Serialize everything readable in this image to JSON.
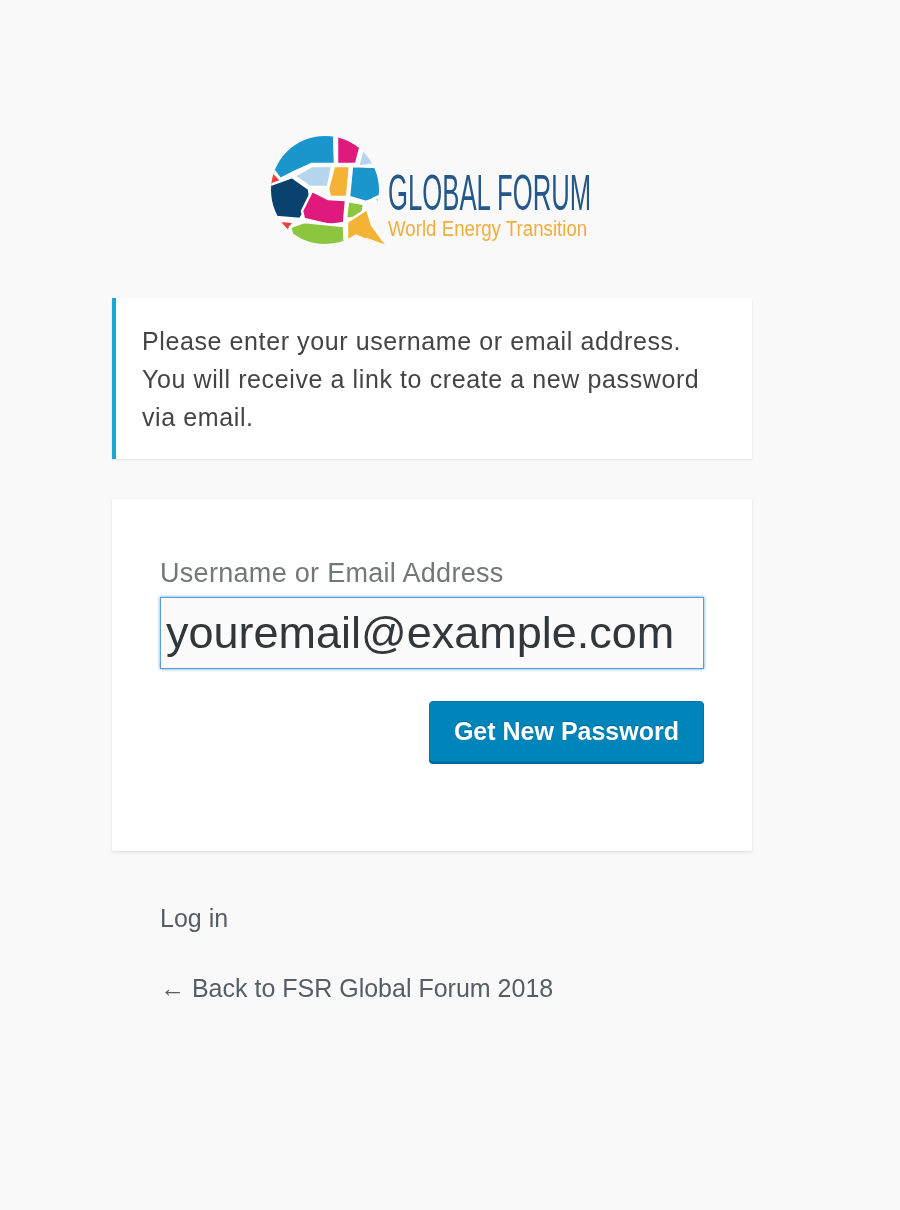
{
  "logo": {
    "title": "GLOBAL FORUM",
    "subtitle": "World Energy Transition"
  },
  "message": "Please enter your username or email address. You will receive a link to create a new password via email.",
  "form": {
    "field": {
      "label": "Username or Email Address",
      "value": "youremail@example.com",
      "focused": true
    },
    "button": "Get New Password"
  },
  "links": [
    {
      "label": "Log in"
    },
    {
      "label": "← Back to FSR Global Forum 2018"
    }
  ]
}
